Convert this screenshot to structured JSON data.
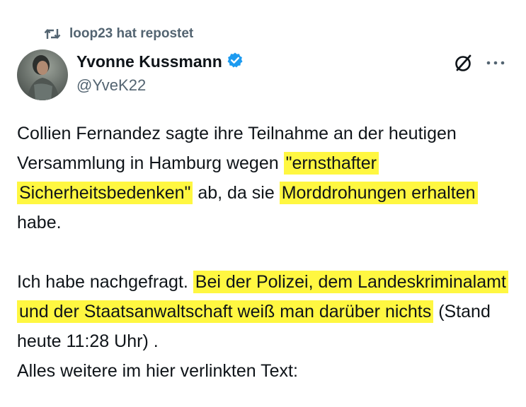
{
  "repost": {
    "icon": "repost-icon",
    "text": "loop23 hat repostet"
  },
  "author": {
    "name": "Yvonne Kussmann",
    "handle": "@YveK22",
    "verified_icon": "verified-badge-icon",
    "verified_color": "#1d9bf0"
  },
  "actions": {
    "grok_icon": "grok-icon",
    "more_icon": "more-icon"
  },
  "tweet": {
    "p1": {
      "s1": "Collien Fernandez sagte ihre Teilnahme an der heutigen Versammlung in Hamburg wegen ",
      "h1": "\"ernsthafter Sicherheitsbedenken\"",
      "s2": " ab, da sie ",
      "h2": "Morddrohungen erhalten",
      "s3": " habe."
    },
    "p2": {
      "s1": "Ich habe nachgefragt. ",
      "h1": "Bei der Polizei, dem Landeskriminalamt und der Staatsanwaltschaft weiß man darüber nichts",
      "s2": " (Stand heute 11:28 Uhr) .",
      "s3": "Alles weitere im hier verlinkten Text:"
    }
  },
  "colors": {
    "highlight": "#fff741",
    "secondary_text": "#536471",
    "primary_text": "#0f1419"
  }
}
